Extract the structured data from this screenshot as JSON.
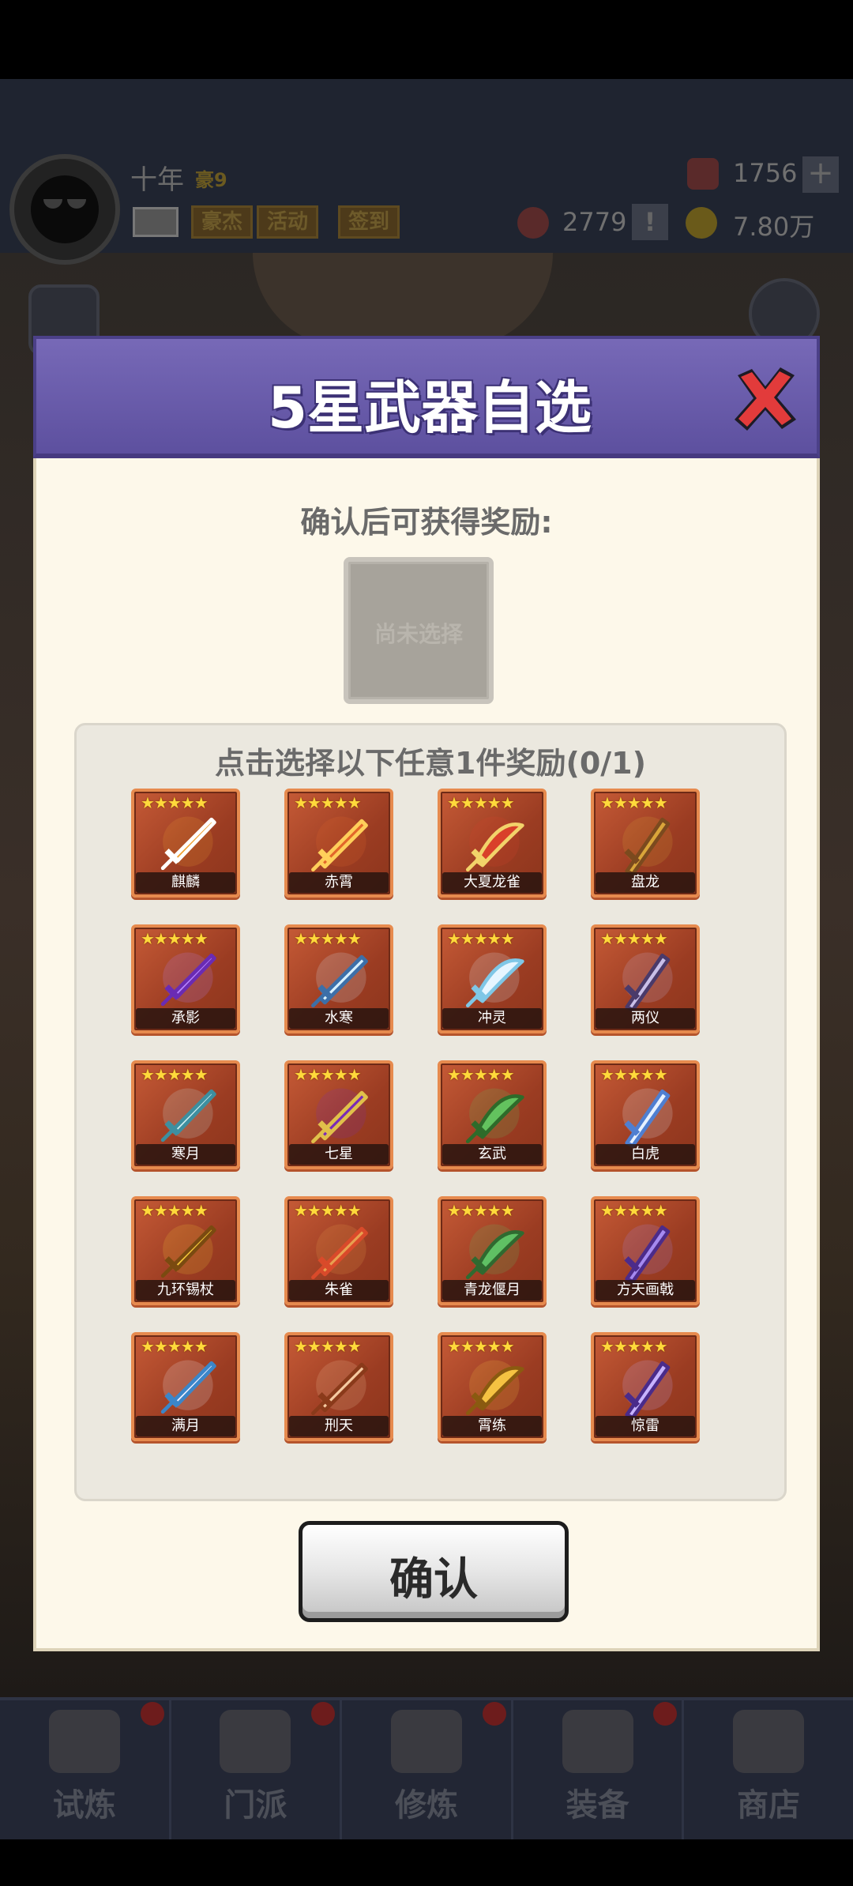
{
  "player": {
    "name": "十年",
    "vip": "豪9"
  },
  "top_buttons": {
    "mail": "mail-icon",
    "tags": [
      "豪杰",
      "活动",
      "签到"
    ]
  },
  "resources": {
    "gems": "1756",
    "tokens": "2779",
    "coins": "7.80万"
  },
  "dialog": {
    "title": "5星武器自选",
    "hint": "确认后可获得奖励:",
    "slot_placeholder": "尚未选择",
    "panel_title": "点击选择以下任意1件奖励(0/1)",
    "confirm_label": "确认",
    "stars": "★★★★★",
    "weapons": [
      {
        "name": "麒麟",
        "icon": "qilin-fire-blade-icon",
        "color": "#f0a030",
        "accent": "#ffffff"
      },
      {
        "name": "赤霄",
        "icon": "red-sword-icon",
        "color": "#e2672a",
        "accent": "#ffcf5a"
      },
      {
        "name": "大夏龙雀",
        "icon": "dragon-broadsword-icon",
        "color": "#d9402a",
        "accent": "#f2d36a"
      },
      {
        "name": "盘龙",
        "icon": "dragon-staff-icon",
        "color": "#d9a53a",
        "accent": "#7b4a1e"
      },
      {
        "name": "承影",
        "icon": "purple-sword-icon",
        "color": "#b987ff",
        "accent": "#6a2bb3"
      },
      {
        "name": "水寒",
        "icon": "ice-sword-icon",
        "color": "#d7f0ff",
        "accent": "#3c6fa8"
      },
      {
        "name": "冲灵",
        "icon": "spirit-sword-icon",
        "color": "#e6f6ff",
        "accent": "#7fc7e6"
      },
      {
        "name": "两仪",
        "icon": "dark-sword-icon",
        "color": "#c9bfe8",
        "accent": "#4a3a6a"
      },
      {
        "name": "寒月",
        "icon": "frost-blade-icon",
        "color": "#cfeef0",
        "accent": "#3d8fa0"
      },
      {
        "name": "七星",
        "icon": "seven-star-blade-icon",
        "color": "#7a2bb5",
        "accent": "#e0c04a"
      },
      {
        "name": "玄武",
        "icon": "tortoise-shield-icon",
        "color": "#63c25e",
        "accent": "#2e6b2a"
      },
      {
        "name": "白虎",
        "icon": "white-tiger-icon",
        "color": "#e8f2ff",
        "accent": "#4f7fd1"
      },
      {
        "name": "九环锡杖",
        "icon": "nine-ring-staff-icon",
        "color": "#f2c53a",
        "accent": "#7a4a10"
      },
      {
        "name": "朱雀",
        "icon": "vermilion-spear-icon",
        "color": "#e8a050",
        "accent": "#d94a2a"
      },
      {
        "name": "青龙偃月",
        "icon": "green-dragon-glaive-icon",
        "color": "#5fc064",
        "accent": "#2f6a30"
      },
      {
        "name": "方天画戟",
        "icon": "halberd-icon",
        "color": "#a58af0",
        "accent": "#4c2b8a"
      },
      {
        "name": "满月",
        "icon": "full-moon-icon",
        "color": "#f2f2ff",
        "accent": "#3b86c9"
      },
      {
        "name": "刑天",
        "icon": "axe-icon",
        "color": "#f5c9a0",
        "accent": "#8a3a1a"
      },
      {
        "name": "霄练",
        "icon": "golden-sword-icon",
        "color": "#f5c242",
        "accent": "#8a5a10"
      },
      {
        "name": "惊雷",
        "icon": "thunder-trident-icon",
        "color": "#c7b3ff",
        "accent": "#4a2b8a"
      }
    ]
  },
  "bottom_nav": [
    "试炼",
    "门派",
    "修炼",
    "装备",
    "商店"
  ]
}
